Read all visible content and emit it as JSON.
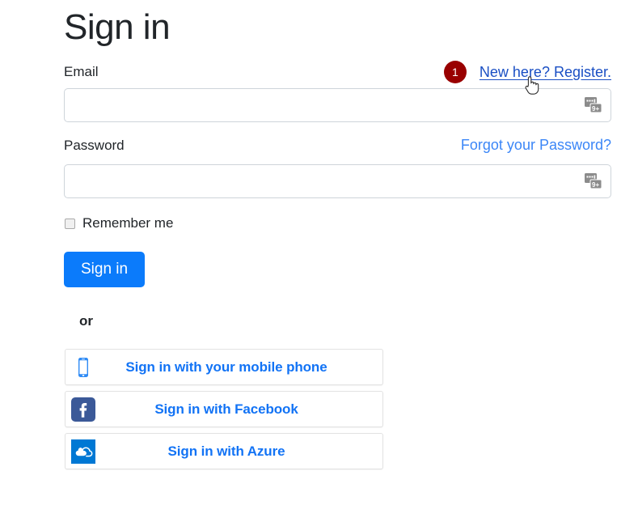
{
  "page": {
    "title": "Sign in"
  },
  "email_field": {
    "label": "Email",
    "value": "",
    "placeholder": "",
    "autofill_icon": "password-manager-icon"
  },
  "register_link": {
    "badge": "1",
    "label": "New here? Register.",
    "color": "#1a4fc4",
    "badge_color": "#990000"
  },
  "password_field": {
    "label": "Password",
    "value": "",
    "placeholder": "",
    "autofill_icon": "password-manager-icon"
  },
  "forgot_link": {
    "label": "Forgot your Password?",
    "color": "#3b86f7"
  },
  "remember_me": {
    "label": "Remember me",
    "checked": false
  },
  "signin_button": {
    "label": "Sign in",
    "color": "#0b7bfb"
  },
  "divider": {
    "label": "or"
  },
  "social_buttons": [
    {
      "label": "Sign in with your mobile phone",
      "icon": "mobile-phone-icon",
      "icon_color": "#2f8bf5"
    },
    {
      "label": "Sign in with Facebook",
      "icon": "facebook-icon",
      "icon_color": "#3b5998"
    },
    {
      "label": "Sign in with Azure",
      "icon": "azure-cloud-icon",
      "icon_color": "#0078d4"
    }
  ],
  "cursor": {
    "icon": "pointer-hand-cursor"
  }
}
